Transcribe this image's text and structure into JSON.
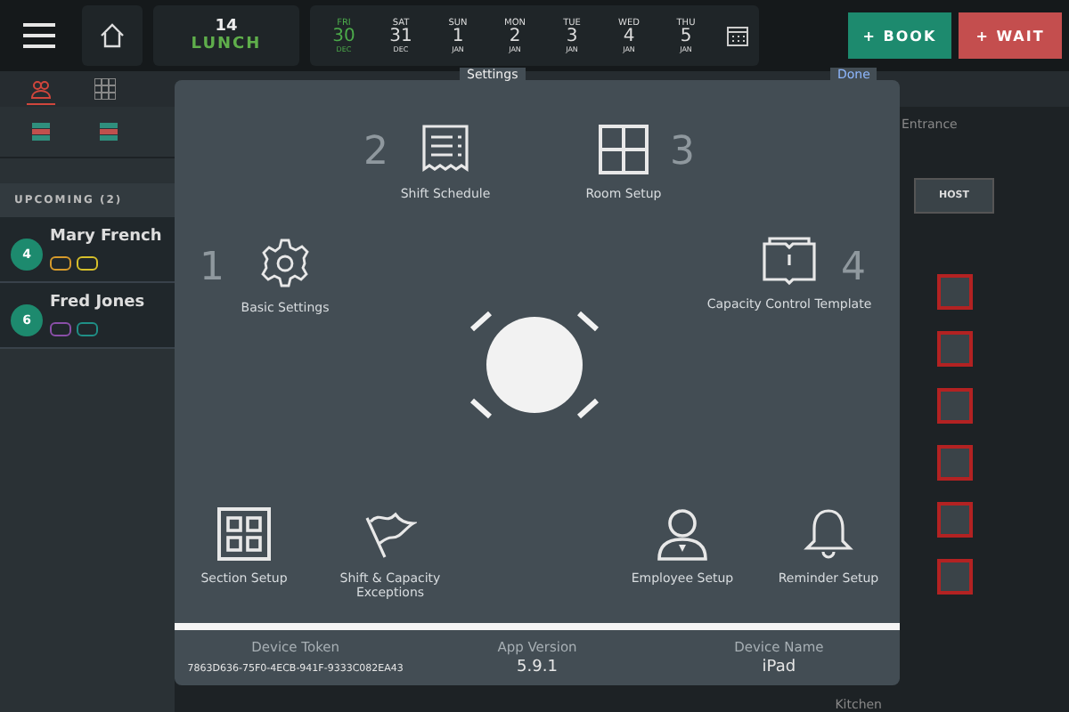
{
  "top_bar": {
    "shift": {
      "count": "14",
      "label": "LUNCH"
    },
    "dates": [
      {
        "weekday": "FRI",
        "day": "30",
        "month": "DEC",
        "selected": true
      },
      {
        "weekday": "SAT",
        "day": "31",
        "month": "DEC",
        "selected": false
      },
      {
        "weekday": "SUN",
        "day": "1",
        "month": "JAN",
        "selected": false
      },
      {
        "weekday": "MON",
        "day": "2",
        "month": "JAN",
        "selected": false
      },
      {
        "weekday": "TUE",
        "day": "3",
        "month": "JAN",
        "selected": false
      },
      {
        "weekday": "WED",
        "day": "4",
        "month": "JAN",
        "selected": false
      },
      {
        "weekday": "THU",
        "day": "5",
        "month": "JAN",
        "selected": false
      }
    ],
    "buttons": [
      {
        "label": "+ BOOK",
        "kind": "book"
      },
      {
        "label": "+ WAIT",
        "kind": "wait"
      }
    ]
  },
  "view_tabs": [
    {
      "kind": "people",
      "selected": true
    },
    {
      "kind": "grid",
      "selected": false
    }
  ],
  "upcoming": {
    "title": "UPCOMING (2)",
    "guests": [
      {
        "party_size": "4",
        "name": "Mary French"
      },
      {
        "party_size": "6",
        "name": "Fred Jones"
      }
    ]
  },
  "floor": {
    "section": "Entrance",
    "host_button": "HOST",
    "bottom_label": "Kitchen"
  },
  "settings": {
    "title": "Settings",
    "done": "Done",
    "items": [
      {
        "kind": "gear",
        "label": "Basic Settings",
        "number": "1"
      },
      {
        "kind": "receipt",
        "label": "Shift Schedule",
        "number": "2"
      },
      {
        "kind": "grid",
        "label": "Room Setup",
        "number": "3"
      },
      {
        "kind": "book",
        "label": "Capacity Control Template",
        "number": "4"
      },
      {
        "kind": "sections",
        "label": "Section Setup"
      },
      {
        "kind": "flag",
        "label": "Shift & Capacity Exceptions"
      },
      {
        "kind": "person",
        "label": "Employee Setup"
      },
      {
        "kind": "bell",
        "label": "Reminder Setup"
      }
    ],
    "footer": [
      {
        "label": "Device Token",
        "value": "7863D636-75F0-4ECB-941F-9333C082EA43"
      },
      {
        "label": "App Version",
        "value": "5.9.1"
      },
      {
        "label": "Device Name",
        "value": "iPad"
      }
    ]
  }
}
